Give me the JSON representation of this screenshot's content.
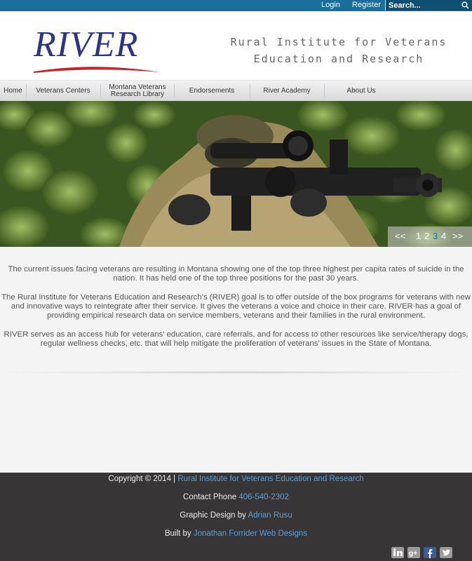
{
  "topbar": {
    "login": "Login",
    "register": "Register",
    "search_placeholder": "Search..."
  },
  "header": {
    "logo_text": "RIVER",
    "tagline_line1": "Rural Institute for Veterans",
    "tagline_line2": "Education and Research"
  },
  "nav": {
    "items": [
      {
        "label": "Home"
      },
      {
        "label": "Veterans Centers"
      },
      {
        "label": "Montana Veterans Research Library"
      },
      {
        "label": "Endorsements"
      },
      {
        "label": "River Academy"
      },
      {
        "label": "About Us"
      }
    ]
  },
  "slider": {
    "prev": "<<",
    "pages": [
      "1",
      "2",
      "3",
      "4"
    ],
    "active_page": "3",
    "next": ">>"
  },
  "content": {
    "paragraphs": [
      "The current issues facing veterans are resulting in Montana showing one of the top three highest per capita rates of suicide in the nation. It has held one of the top three positions for the past 30 years.",
      "The Rural Institute for Veterans Education and Research’s (RIVER) goal is to offer outside of the box programs for veterans with new and innovative ways to reintegrate after their service. It gives the veterans a voice and choice in their care. RIVER has a goal of providing empirical research data on service members, veterans and their families in the rural environment.",
      "RIVER serves as an access hub for veterans' education, care referrals, and for access to other resources like service/therapy dogs, regular wellness checks, etc. that will help mitigate the proliferation of veterans' issues in the State of Montana."
    ]
  },
  "footer": {
    "copyright_prefix": "Copyright © 2014 |",
    "copyright_link": "Rural Institute for Veterans Education and Research",
    "phone_prefix": "Contact Phone",
    "phone": "406-540-2302",
    "design_prefix": "Graphic Design by",
    "designer": "Adrian Rusu",
    "built_prefix": "Built by",
    "builder": "Jonathan Forrider Web Designs",
    "social": [
      "linkedin-icon",
      "google-plus-icon",
      "facebook-icon",
      "twitter-icon"
    ]
  },
  "colors": {
    "topbar": "#1a6f9a",
    "logo_blue": "#2b3486",
    "logo_swoosh": "#c0262c",
    "footer_bg": "#373535",
    "link": "#5aa0d8",
    "active_page": "#1a6f9a"
  }
}
